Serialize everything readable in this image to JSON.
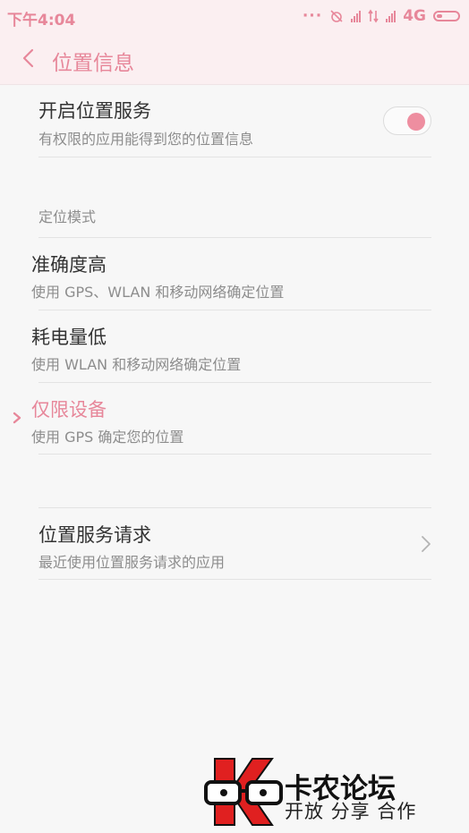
{
  "status": {
    "time": "下午4:04",
    "network": "4G",
    "icons": [
      "more-dots-icon",
      "alarm-off-icon",
      "signal-icon",
      "data-arrows-icon",
      "signal-icon",
      "battery-icon"
    ]
  },
  "header": {
    "title": "位置信息",
    "back_icon": "chevron-left-icon"
  },
  "location_service": {
    "title": "开启位置服务",
    "subtitle": "有权限的应用能得到您的位置信息",
    "enabled": true
  },
  "mode_section": {
    "label": "定位模式",
    "options": [
      {
        "title": "准确度高",
        "subtitle": "使用 GPS、WLAN 和移动网络确定位置",
        "selected": false
      },
      {
        "title": "耗电量低",
        "subtitle": "使用 WLAN 和移动网络确定位置",
        "selected": false
      },
      {
        "title": "仅限设备",
        "subtitle": "使用 GPS 确定您的位置",
        "selected": true
      }
    ]
  },
  "requests": {
    "title": "位置服务请求",
    "subtitle": "最近使用位置服务请求的应用"
  },
  "watermark": {
    "name": "卡农论坛",
    "slogan": "开放 分享 合作"
  },
  "colors": {
    "accent": "#e7879a",
    "header_bg": "#fbeff1",
    "page_bg": "#f7f7f7"
  }
}
